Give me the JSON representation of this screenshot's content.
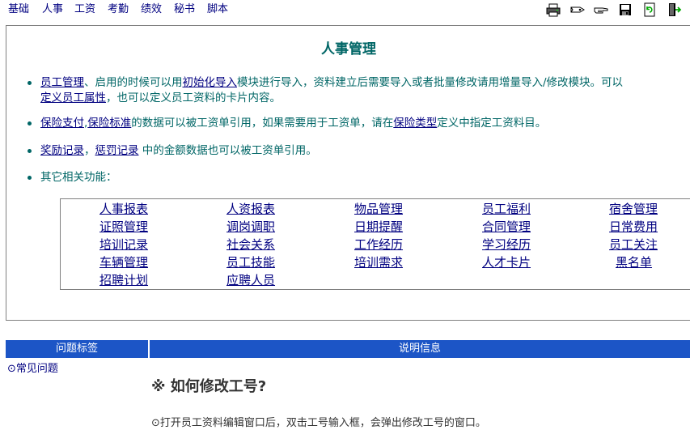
{
  "menu": {
    "items": [
      {
        "label": "基础"
      },
      {
        "label": "人事"
      },
      {
        "label": "工资"
      },
      {
        "label": "考勤"
      },
      {
        "label": "绩效"
      },
      {
        "label": "秘书"
      },
      {
        "label": "脚本"
      }
    ]
  },
  "toolbar": {
    "icons": [
      "printer-icon",
      "tag-icon",
      "hand-pointer-icon",
      "save-disk-icon",
      "refresh-icon",
      "exit-door-icon"
    ]
  },
  "main": {
    "title": "人事管理",
    "bullets": {
      "b1": {
        "link1": "员工管理",
        "text1": "、启用的时候可以用",
        "link2": "初始化导入",
        "text2": "模块进行导入，资料建立后需要导入或者批量修改请用增量导入/修改模块。可以",
        "link3": "定义员工属性",
        "text3": "，也可以定义员工资料的卡片内容。"
      },
      "b2": {
        "link1": "保险支付",
        "text1": ",",
        "link2": "保险标准",
        "text2": "的数据可以被工资单引用，如果需要用于工资单，请在",
        "link3": "保险类型",
        "text3": "定义中指定工资料目。"
      },
      "b3": {
        "link1": "奖励记录",
        "text1": "，",
        "link2": "惩罚记录",
        "text2": " 中的金额数据也可以被工资单引用。"
      },
      "b4": {
        "text1": "其它相关功能："
      }
    },
    "functions": [
      [
        "人事报表",
        "人资报表",
        "物品管理",
        "员工福利",
        "宿舍管理"
      ],
      [
        "证照管理",
        "调岗调职",
        "日期提醒",
        "合同管理",
        "日常费用"
      ],
      [
        "培训记录",
        "社会关系",
        "工作经历",
        "学习经历",
        "员工关注"
      ],
      [
        "车辆管理",
        "员工技能",
        "培训需求",
        "人才卡片",
        "黑名单"
      ],
      [
        "招聘计划",
        "应聘人员"
      ]
    ]
  },
  "bottom": {
    "col1_header": "问题标签",
    "col2_header": "说明信息",
    "tag": "⊙常见问题",
    "question": "※ 如何修改工号?",
    "answer": "⊙打开员工资料编辑窗口后，双击工号输入框，会弹出修改工号的窗口。"
  },
  "colors": {
    "accent": "#1c55c6",
    "text_teal": "#006666",
    "link": "#000080"
  }
}
